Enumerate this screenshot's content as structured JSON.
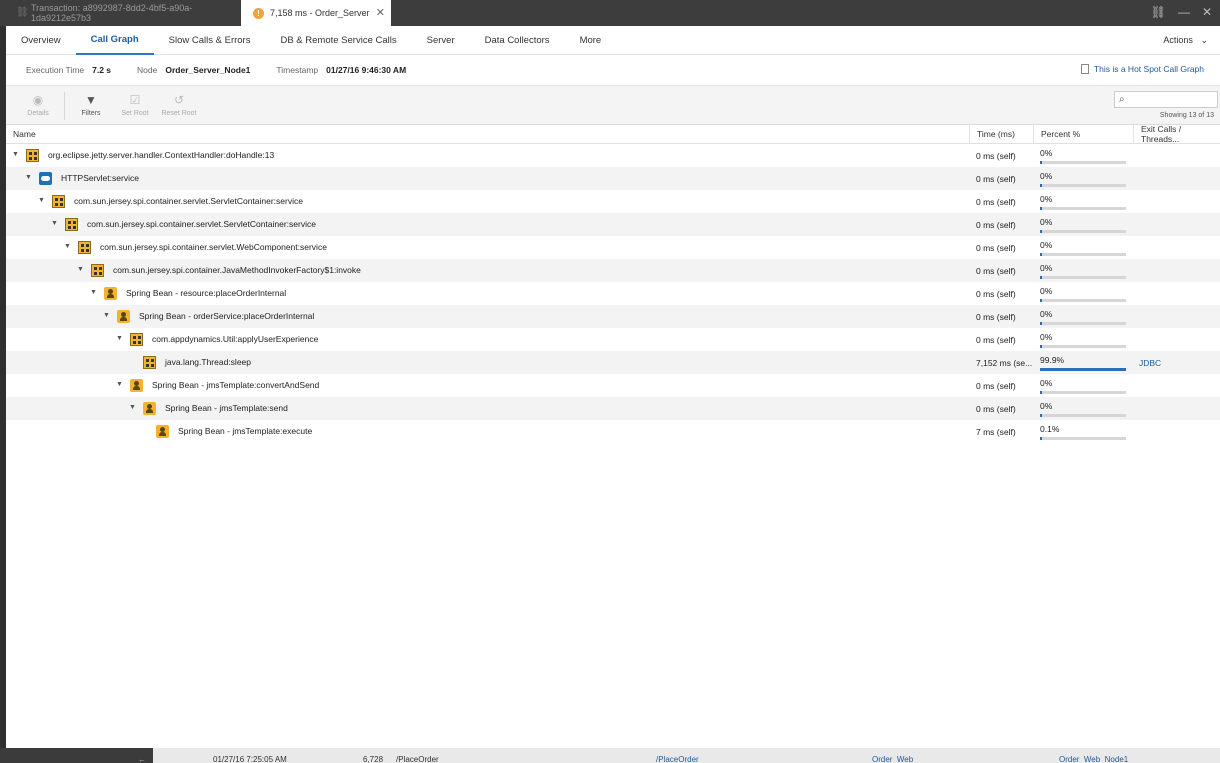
{
  "window": {
    "inactive_tab_label": "Transaction: a8992987-8dd2-4bf5-a90a-1da9212e57b3",
    "active_tab_label": "7,158 ms - Order_Server",
    "warning_glyph": "!",
    "close_glyph": "✕"
  },
  "nav": {
    "tabs": [
      {
        "label": "Overview"
      },
      {
        "label": "Call Graph"
      },
      {
        "label": "Slow Calls & Errors"
      },
      {
        "label": "DB & Remote Service Calls"
      },
      {
        "label": "Server"
      },
      {
        "label": "Data Collectors"
      },
      {
        "label": "More"
      }
    ],
    "active_tab": "Call Graph",
    "actions_label": "Actions"
  },
  "info": {
    "execution_time_label": "Execution Time",
    "execution_time_value": "7.2 s",
    "node_label": "Node",
    "node_value": "Order_Server_Node1",
    "timestamp_label": "Timestamp",
    "timestamp_value": "01/27/16 9:46:30 AM",
    "hotspot_link": "This is a Hot Spot Call Graph"
  },
  "toolbar": {
    "details_label": "Details",
    "filters_label": "Filters",
    "set_root_label": "Set Root",
    "reset_root_label": "Reset Root",
    "search_placeholder": "",
    "showing_text": "Showing 13 of 13"
  },
  "table": {
    "columns": [
      "Name",
      "Time (ms)",
      "Percent %",
      "Exit Calls / Threads..."
    ],
    "rows": [
      {
        "name": "org.eclipse.jetty.server.handler.ContextHandler:doHandle:13",
        "time": "0 ms (self)",
        "percent": "0%",
        "fraction": 0.0,
        "exit": "",
        "icon": "method",
        "depth": 0,
        "expand": true
      },
      {
        "name": "HTTPServlet:service",
        "time": "0 ms (self)",
        "percent": "0%",
        "fraction": 0.0,
        "exit": "",
        "icon": "servlet",
        "depth": 1,
        "expand": true
      },
      {
        "name": "com.sun.jersey.spi.container.servlet.ServletContainer:service",
        "time": "0 ms (self)",
        "percent": "0%",
        "fraction": 0.0,
        "exit": "",
        "icon": "method",
        "depth": 2,
        "expand": true
      },
      {
        "name": "com.sun.jersey.spi.container.servlet.ServletContainer:service",
        "time": "0 ms (self)",
        "percent": "0%",
        "fraction": 0.0,
        "exit": "",
        "icon": "method",
        "depth": 3,
        "expand": true
      },
      {
        "name": "com.sun.jersey.spi.container.servlet.WebComponent:service",
        "time": "0 ms (self)",
        "percent": "0%",
        "fraction": 0.0,
        "exit": "",
        "icon": "method",
        "depth": 4,
        "expand": true
      },
      {
        "name": "com.sun.jersey.spi.container.JavaMethodInvokerFactory$1:invoke",
        "time": "0 ms (self)",
        "percent": "0%",
        "fraction": 0.0,
        "exit": "",
        "icon": "method",
        "depth": 5,
        "expand": true
      },
      {
        "name": "Spring Bean - resource:placeOrderInternal",
        "time": "0 ms (self)",
        "percent": "0%",
        "fraction": 0.0,
        "exit": "",
        "icon": "spring",
        "depth": 6,
        "expand": true
      },
      {
        "name": "Spring Bean - orderService:placeOrderInternal",
        "time": "0 ms (self)",
        "percent": "0%",
        "fraction": 0.0,
        "exit": "",
        "icon": "spring",
        "depth": 7,
        "expand": true
      },
      {
        "name": "com.appdynamics.Util:applyUserExperience",
        "time": "0 ms (self)",
        "percent": "0%",
        "fraction": 0.0,
        "exit": "",
        "icon": "method",
        "depth": 8,
        "expand": true
      },
      {
        "name": "java.lang.Thread:sleep",
        "time": "7,152 ms (se...",
        "percent": "99.9%",
        "fraction": 0.999,
        "exit": "JDBC",
        "icon": "method",
        "depth": 9,
        "expand": false
      },
      {
        "name": "Spring Bean - jmsTemplate:convertAndSend",
        "time": "0 ms (self)",
        "percent": "0%",
        "fraction": 0.0,
        "exit": "",
        "icon": "spring",
        "depth": 8,
        "expand": true
      },
      {
        "name": "Spring Bean - jmsTemplate:send",
        "time": "0 ms (self)",
        "percent": "0%",
        "fraction": 0.0,
        "exit": "",
        "icon": "spring",
        "depth": 9,
        "expand": true
      },
      {
        "name": "Spring Bean - jmsTemplate:execute",
        "time": "7 ms (self)",
        "percent": "0.1%",
        "fraction": 0.001,
        "exit": "",
        "icon": "spring",
        "depth": 10,
        "expand": false
      }
    ]
  },
  "background_row": {
    "timestamp": "01/27/16 7:25:05 AM",
    "value": "6,728",
    "path": "/PlaceOrder",
    "link1": "/PlaceOrder",
    "link2": "Order_Web",
    "link3": "Order_Web_Node1"
  },
  "colors": {
    "accent": "#2a78c7",
    "bar_fill": "#2e6cb3",
    "bar_track": "#d6d6d6",
    "warning": "#f2a23a",
    "method_icon": "#f3b22f"
  }
}
